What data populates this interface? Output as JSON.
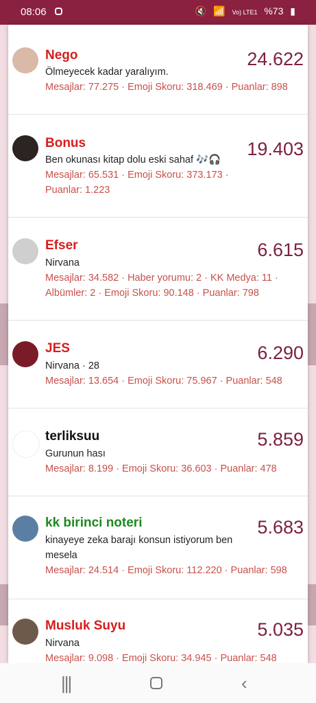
{
  "status_bar": {
    "time": "08:06",
    "battery": "%73",
    "network": "Vo) LTE1"
  },
  "users": [
    {
      "name": "Nego",
      "name_color": "#d61d1d",
      "status": "Ölmeyecek kadar yaralıyım.",
      "stats": "Mesajlar: 77.275 · Emoji Skoru: 318.469 · Puanlar: 898",
      "score": "24.622"
    },
    {
      "name": "Bonus",
      "name_color": "#d61d1d",
      "status": "Ben okunası kitap dolu eski sahaf 🎶🎧",
      "stats": "Mesajlar: 65.531 · Emoji Skoru: 373.173 · Puanlar: 1.223",
      "score": "19.403"
    },
    {
      "name": "Efser",
      "name_color": "#d61d1d",
      "status": "Nirvana",
      "stats": "Mesajlar: 34.582 · Haber yorumu: 2 · KK Medya: 11 · Albümler: 2 · Emoji Skoru: 90.148 · Puanlar: 798",
      "score": "6.615"
    },
    {
      "name": "JES",
      "name_color": "#d61d1d",
      "status": "Nirvana · 28",
      "stats": "Mesajlar: 13.654 · Emoji Skoru: 75.967 · Puanlar: 548",
      "score": "6.290"
    },
    {
      "name": "terliksuu",
      "name_color": "#111111",
      "status": "Gurunun hası",
      "stats": "Mesajlar: 8.199 · Emoji Skoru: 36.603 · Puanlar: 478",
      "score": "5.859"
    },
    {
      "name": "kk birinci noteri",
      "name_color": "#1d8a1d",
      "status": "kinayeye zeka barajı konsun istiyorum ben mesela",
      "stats": "Mesajlar: 24.514 · Emoji Skoru: 112.220 · Puanlar: 598",
      "score": "5.683"
    },
    {
      "name": "Musluk Suyu",
      "name_color": "#d61d1d",
      "status": "Nirvana",
      "stats": "Mesajlar: 9.098 · Emoji Skoru: 34.945 · Puanlar: 548",
      "score": "5.035"
    }
  ],
  "icons": {
    "recents": "recents-icon",
    "home": "home-icon",
    "back": "back-icon"
  }
}
